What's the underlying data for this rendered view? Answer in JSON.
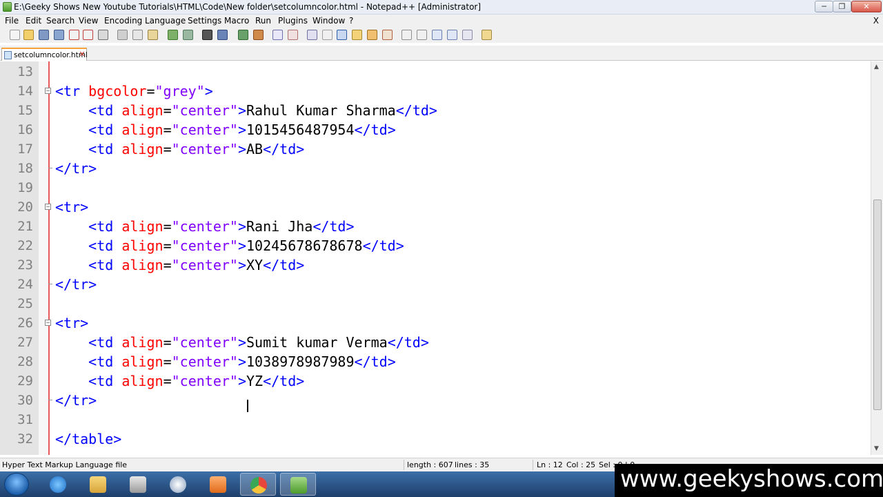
{
  "window": {
    "title": "E:\\Geeky Shows New Youtube Tutorials\\HTML\\Code\\New folder\\setcolumncolor.html - Notepad++ [Administrator]",
    "minimize": "─",
    "maximize": "❐",
    "close": "✕"
  },
  "menu": {
    "items": [
      "File",
      "Edit",
      "Search",
      "View",
      "Encoding",
      "Language",
      "Settings",
      "Macro",
      "Run",
      "Plugins",
      "Window",
      "?"
    ],
    "doc_close": "X"
  },
  "tabs": [
    {
      "label": "setcolumncolor.html",
      "close": "✕"
    }
  ],
  "editor": {
    "lines": [
      {
        "num": "13",
        "fold": "",
        "parts": []
      },
      {
        "num": "14",
        "fold": "open",
        "parts": [
          {
            "cls": "tag",
            "t": "<tr "
          },
          {
            "cls": "attr",
            "t": "bgcolor"
          },
          {
            "cls": "txt",
            "t": "="
          },
          {
            "cls": "val",
            "t": "\"grey\""
          },
          {
            "cls": "tag",
            "t": ">"
          }
        ]
      },
      {
        "num": "15",
        "fold": "",
        "parts": [
          {
            "cls": "txt",
            "t": "    "
          },
          {
            "cls": "tag",
            "t": "<td "
          },
          {
            "cls": "attr",
            "t": "align"
          },
          {
            "cls": "txt",
            "t": "="
          },
          {
            "cls": "val",
            "t": "\"center\""
          },
          {
            "cls": "tag",
            "t": ">"
          },
          {
            "cls": "txt",
            "t": "Rahul Kumar Sharma"
          },
          {
            "cls": "tag",
            "t": "</td>"
          }
        ]
      },
      {
        "num": "16",
        "fold": "",
        "parts": [
          {
            "cls": "txt",
            "t": "    "
          },
          {
            "cls": "tag",
            "t": "<td "
          },
          {
            "cls": "attr",
            "t": "align"
          },
          {
            "cls": "txt",
            "t": "="
          },
          {
            "cls": "val",
            "t": "\"center\""
          },
          {
            "cls": "tag",
            "t": ">"
          },
          {
            "cls": "txt",
            "t": "1015456487954"
          },
          {
            "cls": "tag",
            "t": "</td>"
          }
        ]
      },
      {
        "num": "17",
        "fold": "",
        "parts": [
          {
            "cls": "txt",
            "t": "    "
          },
          {
            "cls": "tag",
            "t": "<td "
          },
          {
            "cls": "attr",
            "t": "align"
          },
          {
            "cls": "txt",
            "t": "="
          },
          {
            "cls": "val",
            "t": "\"center\""
          },
          {
            "cls": "tag",
            "t": ">"
          },
          {
            "cls": "txt",
            "t": "AB"
          },
          {
            "cls": "tag",
            "t": "</td>"
          }
        ]
      },
      {
        "num": "18",
        "fold": "end",
        "parts": [
          {
            "cls": "tag",
            "t": "</tr>"
          }
        ]
      },
      {
        "num": "19",
        "fold": "",
        "parts": []
      },
      {
        "num": "20",
        "fold": "open",
        "parts": [
          {
            "cls": "tag",
            "t": "<tr>"
          }
        ]
      },
      {
        "num": "21",
        "fold": "",
        "parts": [
          {
            "cls": "txt",
            "t": "    "
          },
          {
            "cls": "tag",
            "t": "<td "
          },
          {
            "cls": "attr",
            "t": "align"
          },
          {
            "cls": "txt",
            "t": "="
          },
          {
            "cls": "val",
            "t": "\"center\""
          },
          {
            "cls": "tag",
            "t": ">"
          },
          {
            "cls": "txt",
            "t": "Rani Jha"
          },
          {
            "cls": "tag",
            "t": "</td>"
          }
        ]
      },
      {
        "num": "22",
        "fold": "",
        "parts": [
          {
            "cls": "txt",
            "t": "    "
          },
          {
            "cls": "tag",
            "t": "<td "
          },
          {
            "cls": "attr",
            "t": "align"
          },
          {
            "cls": "txt",
            "t": "="
          },
          {
            "cls": "val",
            "t": "\"center\""
          },
          {
            "cls": "tag",
            "t": ">"
          },
          {
            "cls": "txt",
            "t": "10245678678678"
          },
          {
            "cls": "tag",
            "t": "</td>"
          }
        ]
      },
      {
        "num": "23",
        "fold": "",
        "parts": [
          {
            "cls": "txt",
            "t": "    "
          },
          {
            "cls": "tag",
            "t": "<td "
          },
          {
            "cls": "attr",
            "t": "align"
          },
          {
            "cls": "txt",
            "t": "="
          },
          {
            "cls": "val",
            "t": "\"center\""
          },
          {
            "cls": "tag",
            "t": ">"
          },
          {
            "cls": "txt",
            "t": "XY"
          },
          {
            "cls": "tag",
            "t": "</td>"
          }
        ]
      },
      {
        "num": "24",
        "fold": "end",
        "parts": [
          {
            "cls": "tag",
            "t": "</tr>"
          }
        ]
      },
      {
        "num": "25",
        "fold": "",
        "parts": []
      },
      {
        "num": "26",
        "fold": "open",
        "parts": [
          {
            "cls": "tag",
            "t": "<tr>"
          }
        ]
      },
      {
        "num": "27",
        "fold": "",
        "parts": [
          {
            "cls": "txt",
            "t": "    "
          },
          {
            "cls": "tag",
            "t": "<td "
          },
          {
            "cls": "attr",
            "t": "align"
          },
          {
            "cls": "txt",
            "t": "="
          },
          {
            "cls": "val",
            "t": "\"center\""
          },
          {
            "cls": "tag",
            "t": ">"
          },
          {
            "cls": "txt",
            "t": "Sumit kumar Verma"
          },
          {
            "cls": "tag",
            "t": "</td>"
          }
        ]
      },
      {
        "num": "28",
        "fold": "",
        "parts": [
          {
            "cls": "txt",
            "t": "    "
          },
          {
            "cls": "tag",
            "t": "<td "
          },
          {
            "cls": "attr",
            "t": "align"
          },
          {
            "cls": "txt",
            "t": "="
          },
          {
            "cls": "val",
            "t": "\"center\""
          },
          {
            "cls": "tag",
            "t": ">"
          },
          {
            "cls": "txt",
            "t": "1038978987989"
          },
          {
            "cls": "tag",
            "t": "</td>"
          }
        ]
      },
      {
        "num": "29",
        "fold": "",
        "parts": [
          {
            "cls": "txt",
            "t": "    "
          },
          {
            "cls": "tag",
            "t": "<td "
          },
          {
            "cls": "attr",
            "t": "align"
          },
          {
            "cls": "txt",
            "t": "="
          },
          {
            "cls": "val",
            "t": "\"center\""
          },
          {
            "cls": "tag",
            "t": ">"
          },
          {
            "cls": "txt",
            "t": "YZ"
          },
          {
            "cls": "tag",
            "t": "</td>"
          }
        ]
      },
      {
        "num": "30",
        "fold": "end",
        "parts": [
          {
            "cls": "tag",
            "t": "</tr>"
          }
        ]
      },
      {
        "num": "31",
        "fold": "",
        "parts": []
      },
      {
        "num": "32",
        "fold": "",
        "parts": [
          {
            "cls": "tag",
            "t": "</table>"
          }
        ]
      }
    ]
  },
  "status": {
    "file_type": "Hyper Text Markup Language file",
    "length": "length : 607",
    "lines": "lines : 35",
    "ln": "Ln : 12",
    "col": "Col : 25",
    "sel": "Sel : 0 | 0"
  },
  "watermark": "www.geekyshows.com",
  "colors": {
    "tag": "#0000ff",
    "attr": "#ff0000",
    "value": "#8000ff",
    "text": "#000000",
    "line_number": "#808080",
    "fold_margin_line": "#e85a5a",
    "tab_accent": "#f7a13a"
  },
  "taskbar": {
    "apps": [
      "start-orb-icon",
      "internet-explorer-icon",
      "file-explorer-icon",
      "library-icon",
      "snipping-tool-icon",
      "media-player-icon",
      "chrome-icon",
      "notepad-plus-plus-icon"
    ]
  }
}
